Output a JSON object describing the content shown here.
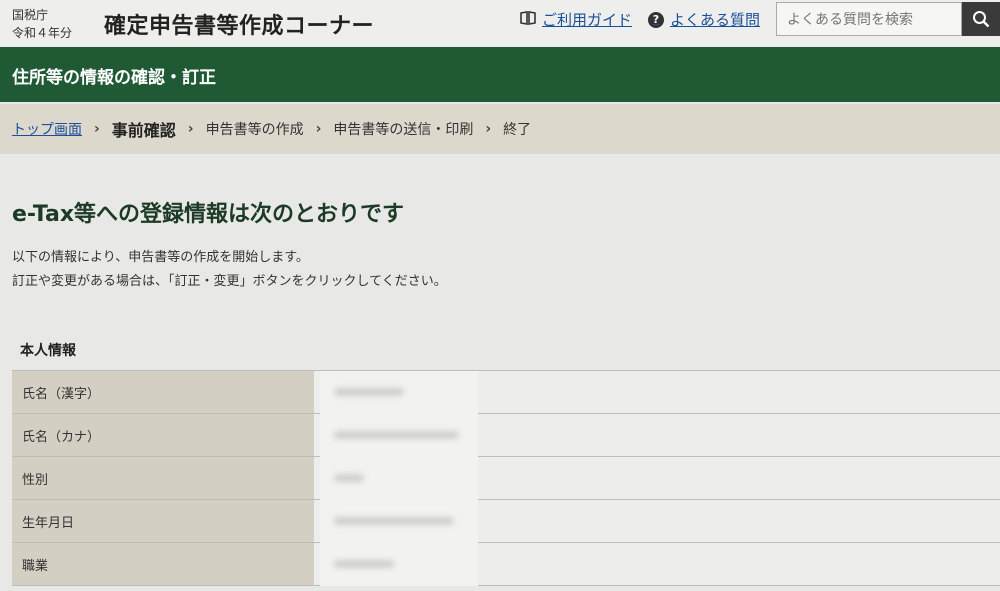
{
  "header": {
    "agency_line1": "国税庁",
    "agency_line2": "令和４年分",
    "app_title": "確定申告書等作成コーナー",
    "guide_link": "ご利用ガイド",
    "faq_link": "よくある質問",
    "search_placeholder": "よくある質問を検索",
    "icons": {
      "guide": "book-icon",
      "faq": "question-circle-icon",
      "search": "search-icon"
    }
  },
  "page_bar": {
    "title": "住所等の情報の確認・訂正"
  },
  "breadcrumb": {
    "items": [
      "トップ画面",
      "事前確認",
      "申告書等の作成",
      "申告書等の送信・印刷",
      "終了"
    ],
    "separator": "›"
  },
  "main": {
    "heading": "e-Tax等への登録情報は次のとおりです",
    "intro_line1": "以下の情報により、申告書等の作成を開始します。",
    "intro_line2": "訂正や変更がある場合は、「訂正・変更」ボタンをクリックしてください。",
    "section_title": "本人情報",
    "rows": [
      {
        "label": "氏名（漢字）"
      },
      {
        "label": "氏名（カナ）"
      },
      {
        "label": "性別"
      },
      {
        "label": "生年月日"
      },
      {
        "label": "職業"
      }
    ]
  },
  "colors": {
    "green_bar": "#1f5a35",
    "link": "#1a4f9a",
    "breadcrumb_bg": "#dcd8cc",
    "label_bg": "#d3cfc2"
  }
}
